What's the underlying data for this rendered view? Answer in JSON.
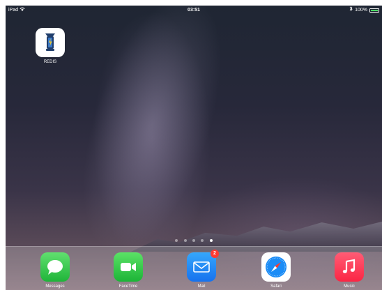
{
  "status_bar": {
    "device": "iPad",
    "time": "03:51",
    "battery": "100%",
    "battery_level": 1.0
  },
  "home": {
    "apps": [
      {
        "label": "REDIS",
        "icon": "lantern-icon"
      }
    ],
    "page_count": 5,
    "active_page": 5
  },
  "dock": {
    "apps": [
      {
        "label": "Messages",
        "icon": "messages-icon",
        "color": "#39c84e"
      },
      {
        "label": "FaceTime",
        "icon": "facetime-icon",
        "color": "#35c74f"
      },
      {
        "label": "Mail",
        "icon": "mail-icon",
        "color": "#1b8cf6",
        "badge": "2"
      },
      {
        "label": "Safari",
        "icon": "safari-icon",
        "color": "#1a7cf5"
      },
      {
        "label": "Music",
        "icon": "music-icon",
        "color": "#fb3655"
      }
    ]
  }
}
